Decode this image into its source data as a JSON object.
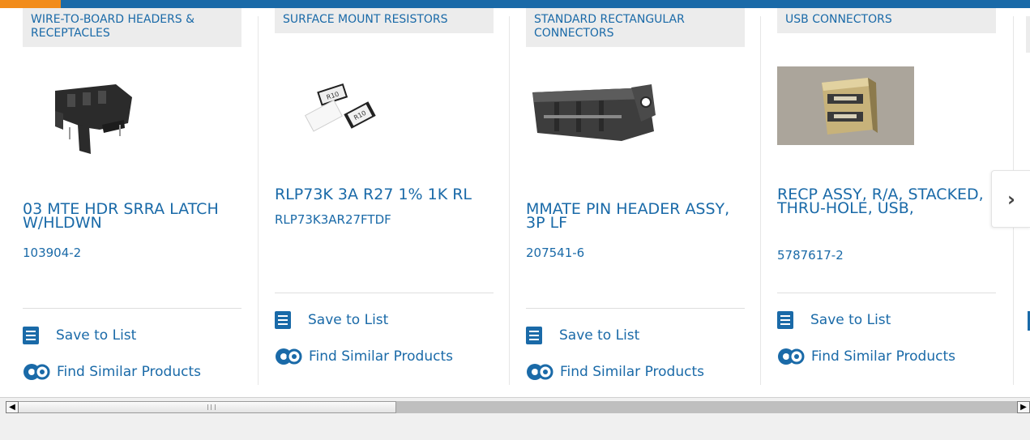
{
  "cards": [
    {
      "category": "WIRE-TO-BOARD HEADERS & RECEPTACLES",
      "title": "03 MTE HDR SRRA LATCH W/HLDWN",
      "part": "103904-2",
      "save": "Save to List",
      "similar": "Find Similar Products"
    },
    {
      "category": "SURFACE MOUNT RESISTORS",
      "title": "RLP73K 3A R27 1% 1K RL",
      "part": "RLP73K3AR27FTDF",
      "save": "Save to List",
      "similar": "Find Similar Products"
    },
    {
      "category": "STANDARD RECTANGULAR CONNECTORS",
      "title": "MMATE PIN HEADER ASSY, 3P LF",
      "part": "207541-6",
      "save": "Save to List",
      "similar": "Find Similar Products"
    },
    {
      "category": "USB CONNECTORS",
      "title": "RECP ASSY, R/A, STACKED, THRU-HOLE, USB,",
      "part": "5787617-2",
      "save": "Save to List",
      "similar": "Find Similar Products"
    }
  ],
  "nav": {
    "next_icon": "chevron-right-icon",
    "next_glyph": "›"
  },
  "scrollbar": {
    "left_glyph": "◀",
    "right_glyph": "▶"
  },
  "colors": {
    "link": "#1a6aa8",
    "accent": "#f28c1b",
    "category_bg": "#ececec"
  }
}
